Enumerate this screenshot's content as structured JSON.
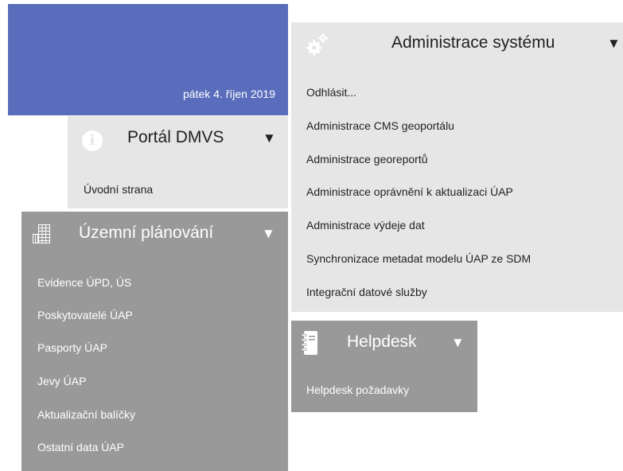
{
  "date": "pátek 4. říjen 2019",
  "portal": {
    "title": "Portál DMVS",
    "arrow": "▼",
    "info_glyph": "i",
    "items": [
      "Úvodní strana"
    ]
  },
  "uzemni": {
    "title": "Územní plánování",
    "arrow": "▼",
    "items": [
      "Evidence ÚPD, ÚS",
      "Poskytovatelé ÚAP",
      "Pasporty ÚAP",
      "Jevy ÚAP",
      "Aktualizační balíčky",
      "Ostatní data ÚAP"
    ]
  },
  "admin": {
    "title": "Administrace systému",
    "arrow": "▼",
    "items": [
      "Odhlásit...",
      "Administrace CMS geoportálu",
      "Administrace georeportů",
      "Administrace oprávnění k aktualizaci ÚAP",
      "Administrace výdeje dat",
      "Synchronizace metadat modelu ÚAP ze SDM",
      "Integrační datové služby"
    ]
  },
  "helpdesk": {
    "title": "Helpdesk",
    "arrow": "▼",
    "items": [
      "Helpdesk požadavky"
    ]
  },
  "colors": {
    "date_panel": "#5a6dbc",
    "light_panel": "#e6e6e6",
    "dark_panel": "#999999"
  }
}
